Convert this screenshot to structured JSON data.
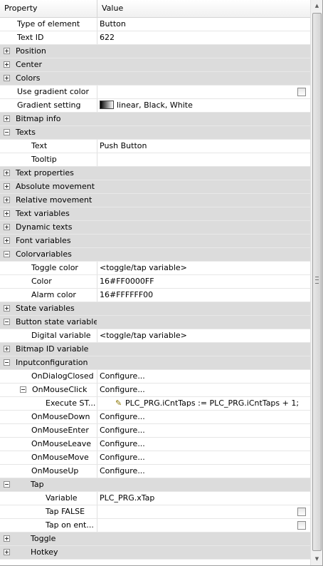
{
  "header": {
    "property": "Property",
    "value": "Value"
  },
  "rows": [
    {
      "type": "prop",
      "level": 1,
      "name": "Type of element",
      "value": "Button"
    },
    {
      "type": "prop",
      "level": 1,
      "name": "Text ID",
      "value": "622"
    },
    {
      "type": "cat",
      "level": 0,
      "expander": "plus",
      "name": "Position"
    },
    {
      "type": "cat",
      "level": 0,
      "expander": "plus",
      "name": "Center"
    },
    {
      "type": "cat",
      "level": 0,
      "expander": "plus",
      "name": "Colors"
    },
    {
      "type": "prop",
      "level": 1,
      "name": "Use gradient color",
      "checkbox": true
    },
    {
      "type": "prop",
      "level": 1,
      "name": "Gradient setting",
      "value": "linear, Black, White",
      "swatch": true
    },
    {
      "type": "cat",
      "level": 0,
      "expander": "plus",
      "name": "Bitmap info"
    },
    {
      "type": "cat",
      "level": 0,
      "expander": "minus",
      "name": "Texts"
    },
    {
      "type": "prop",
      "level": 2,
      "name": "Text",
      "value": "Push Button"
    },
    {
      "type": "prop",
      "level": 2,
      "name": "Tooltip",
      "value": ""
    },
    {
      "type": "cat",
      "level": 0,
      "expander": "plus",
      "name": "Text properties"
    },
    {
      "type": "cat",
      "level": 0,
      "expander": "plus",
      "name": "Absolute movement"
    },
    {
      "type": "cat",
      "level": 0,
      "expander": "plus",
      "name": "Relative movement"
    },
    {
      "type": "cat",
      "level": 0,
      "expander": "plus",
      "name": "Text variables"
    },
    {
      "type": "cat",
      "level": 0,
      "expander": "plus",
      "name": "Dynamic texts"
    },
    {
      "type": "cat",
      "level": 0,
      "expander": "plus",
      "name": "Font variables"
    },
    {
      "type": "cat",
      "level": 0,
      "expander": "minus",
      "name": "Colorvariables"
    },
    {
      "type": "prop",
      "level": 2,
      "name": "Toggle color",
      "value": "<toggle/tap variable>"
    },
    {
      "type": "prop",
      "level": 2,
      "name": "Color",
      "value": "16#FF0000FF"
    },
    {
      "type": "prop",
      "level": 2,
      "name": "Alarm color",
      "value": "16#FFFFFF00"
    },
    {
      "type": "cat",
      "level": 0,
      "expander": "plus",
      "name": "State variables"
    },
    {
      "type": "cat",
      "level": 0,
      "expander": "minus",
      "name": "Button state variable"
    },
    {
      "type": "prop",
      "level": 2,
      "name": "Digital variable",
      "value": "<toggle/tap variable>"
    },
    {
      "type": "cat",
      "level": 0,
      "expander": "plus",
      "name": "Bitmap ID variable"
    },
    {
      "type": "cat",
      "level": 0,
      "expander": "minus",
      "name": "Inputconfiguration"
    },
    {
      "type": "prop",
      "level": 2,
      "name": "OnDialogClosed",
      "value": "Configure..."
    },
    {
      "type": "prop",
      "level": 1,
      "expander": "minus",
      "name": "OnMouseClick",
      "value": "Configure..."
    },
    {
      "type": "prop",
      "level": 3,
      "name": "Execute ST...",
      "value": "PLC_PRG.iCntTaps :=  PLC_PRG.iCntTaps + 1;",
      "pencil": true
    },
    {
      "type": "prop",
      "level": 2,
      "name": "OnMouseDown",
      "value": "Configure..."
    },
    {
      "type": "prop",
      "level": 2,
      "name": "OnMouseEnter",
      "value": "Configure..."
    },
    {
      "type": "prop",
      "level": 2,
      "name": "OnMouseLeave",
      "value": "Configure..."
    },
    {
      "type": "prop",
      "level": 2,
      "name": "OnMouseMove",
      "value": "Configure..."
    },
    {
      "type": "prop",
      "level": 2,
      "name": "OnMouseUp",
      "value": "Configure..."
    },
    {
      "type": "cat",
      "level": 1,
      "expander": "minus",
      "name": "Tap"
    },
    {
      "type": "prop",
      "level": 3,
      "name": "Variable",
      "value": "PLC_PRG.xTap"
    },
    {
      "type": "prop",
      "level": 3,
      "name": "Tap FALSE",
      "checkbox": true
    },
    {
      "type": "prop",
      "level": 3,
      "name": "Tap on ent...",
      "checkbox": true
    },
    {
      "type": "cat",
      "level": 1,
      "expander": "plus",
      "name": "Toggle"
    },
    {
      "type": "cat",
      "level": 1,
      "expander": "plus",
      "name": "Hotkey"
    }
  ]
}
